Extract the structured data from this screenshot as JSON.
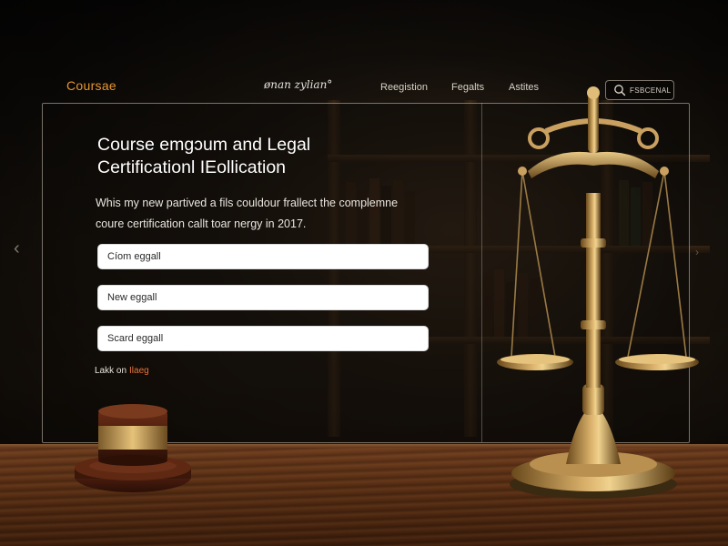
{
  "header": {
    "brand": "Coursae",
    "logo_text": "ønan zylian°",
    "nav": [
      "Reegistion",
      "Fegalts",
      "Astites"
    ],
    "search_label": "FSBCENAL"
  },
  "main": {
    "title_lines": [
      "Course emgɔum and Legal",
      "Certificationl IEollication"
    ],
    "description_lines": [
      "Whis my new partived a fils couldour frallect the complemne",
      "coure certification callt toar nergy in 2017."
    ],
    "fields": [
      {
        "placeholder": "Cíom eggall"
      },
      {
        "placeholder": "New eggall"
      },
      {
        "placeholder": "Scard eggall"
      }
    ],
    "login_prefix": "Lakk on",
    "login_link": "Ilaeg"
  },
  "colors": {
    "accent": "#e8952e",
    "link": "#e8743a",
    "background": "#0b0907",
    "desk": "#5a2f14"
  }
}
